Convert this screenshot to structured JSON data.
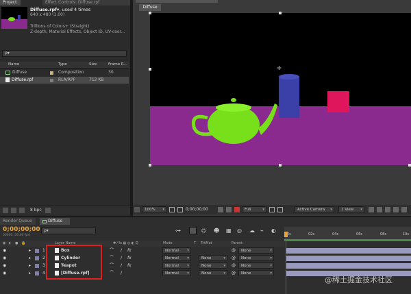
{
  "project_panel": {
    "tabs": [
      "Project",
      "Effect Controls: Diffuse.rpf"
    ],
    "selected_name": "Diffuse.rpf",
    "usage": ", used 4 times",
    "dims": "640 x 480 (1.00)",
    "colors": "Trillions of Colors+ (Straight)",
    "channels": "Z-depth, Material Effects, Object ID, UV-coor...",
    "search_placeholder": "ρ▾",
    "columns": [
      "Name",
      "Type",
      "Size",
      "Frame R..."
    ],
    "items": [
      {
        "name": "Diffuse",
        "type": "Composition",
        "size": "",
        "rate": "30"
      },
      {
        "name": "Diffuse.rpf",
        "type": "RLA/RPF",
        "size": "712 KB",
        "rate": ""
      }
    ],
    "bpc": "8 bpc"
  },
  "viewer": {
    "tab": "Diffuse",
    "zoom": "100%",
    "timecode": "0;00;00;00",
    "resolution": "Full",
    "camera": "Active Camera",
    "views": "1 View"
  },
  "timeline": {
    "tabs": [
      "Render Queue",
      "Diffuse"
    ],
    "current_time": "0;00;00;00",
    "fps_note": "00000 (30.00 fps)",
    "search_placeholder": "ρ▾",
    "columns": {
      "layer_name": "Layer Name",
      "mode": "Mode",
      "t": "T",
      "trkmat": "TrkMat",
      "parent": "Parent"
    },
    "ruler_ticks": [
      "0s",
      "02s",
      "04s",
      "06s",
      "08s",
      "10s"
    ],
    "layers": [
      {
        "num": "1",
        "name": "Box",
        "mode": "Normal",
        "trkmat": "",
        "parent": "None"
      },
      {
        "num": "2",
        "name": "Cylinder",
        "mode": "Normal",
        "trkmat": "None",
        "parent": "None"
      },
      {
        "num": "3",
        "name": "Teapot",
        "mode": "Normal",
        "trkmat": "None",
        "parent": "None"
      },
      {
        "num": "4",
        "name": "[Diffuse.rpf]",
        "mode": "Normal",
        "trkmat": "None",
        "parent": "None"
      }
    ],
    "fx_glyph": "fx"
  },
  "watermark": "@稀土掘金技术社区",
  "colors": {
    "highlight_box": "#e0201e",
    "purple_floor": "#8b2a8e",
    "teapot": "#77e01a",
    "cylinder": "#3b3fa8",
    "box": "#e0165c",
    "timecode": "#e8a23a"
  }
}
